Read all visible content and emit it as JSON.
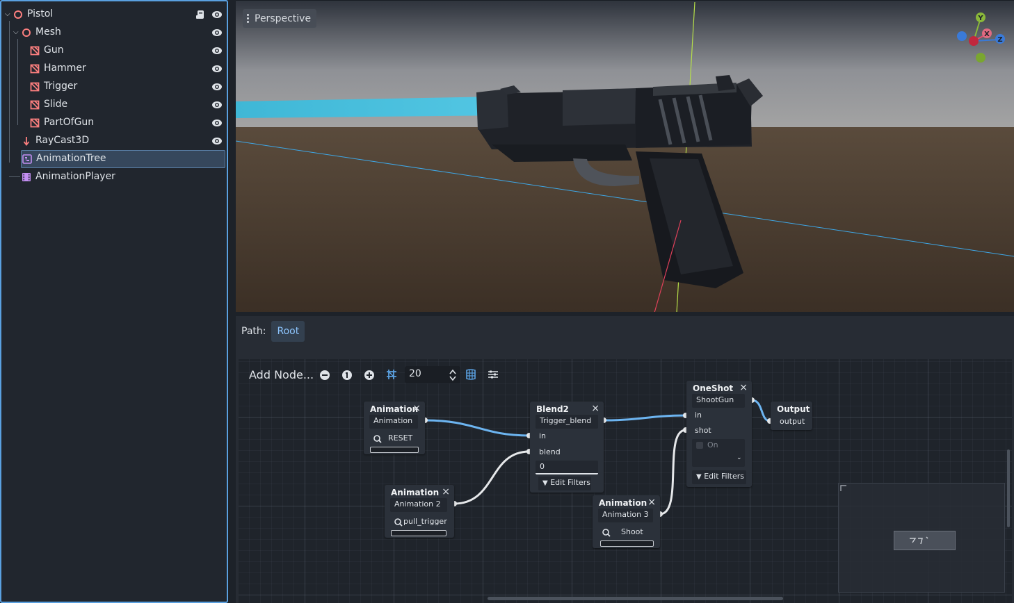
{
  "scene_tree": {
    "nodes": [
      {
        "label": "Pistol",
        "icon": "node3d-icon"
      },
      {
        "label": "Mesh",
        "icon": "node3d-icon"
      },
      {
        "label": "Gun",
        "icon": "mesh-instance-icon"
      },
      {
        "label": "Hammer",
        "icon": "mesh-instance-icon"
      },
      {
        "label": "Trigger",
        "icon": "mesh-instance-icon"
      },
      {
        "label": "Slide",
        "icon": "mesh-instance-icon"
      },
      {
        "label": "PartOfGun",
        "icon": "mesh-instance-icon"
      },
      {
        "label": "RayCast3D",
        "icon": "raycast-icon"
      },
      {
        "label": "AnimationTree",
        "icon": "animation-tree-icon"
      },
      {
        "label": "AnimationPlayer",
        "icon": "animation-player-icon"
      }
    ],
    "selected": "AnimationTree"
  },
  "viewport": {
    "mode_label": "Perspective",
    "gizmo": {
      "y": "Y",
      "x": "X",
      "z": "Z"
    }
  },
  "animation_tree": {
    "path_label": "Path:",
    "path_root": "Root",
    "toolbar": {
      "add_node": "Add Node...",
      "snap_value": "20"
    },
    "nodes": {
      "anim1": {
        "title": "Animation",
        "output": "Animation",
        "clip": "RESET"
      },
      "anim2": {
        "title": "Animation",
        "output": "Animation 2",
        "clip": "pull_trigger"
      },
      "anim3": {
        "title": "Animation",
        "output": "Animation 3",
        "clip": "Shoot"
      },
      "blend2": {
        "title": "Blend2",
        "output": "Trigger_blend",
        "in": "in",
        "blend": "blend",
        "value": "0",
        "filters": "Edit Filters"
      },
      "oneshot": {
        "title": "OneShot",
        "output": "ShootGun",
        "in": "in",
        "shot": "shot",
        "toggle": "On",
        "filters": "Edit Filters"
      },
      "output": {
        "title": "Output",
        "port": "output"
      }
    }
  },
  "colors": {
    "accent": "#5aa0e0",
    "connection_active": "#6cb4f0",
    "connection_idle": "#e6e8ea",
    "node_red": "#fc7f7f",
    "node_purple": "#c38ef1"
  }
}
